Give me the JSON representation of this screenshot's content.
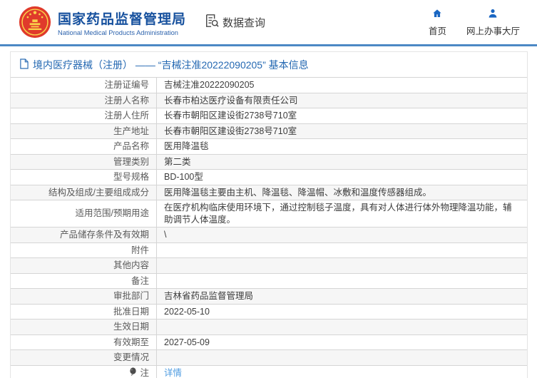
{
  "header": {
    "emblem_icon": "china-national-emblem",
    "title_cn": "国家药品监督管理局",
    "title_en": "National Medical Products Administration",
    "data_query": {
      "label": "数据查询",
      "icon": "document-search-icon"
    },
    "nav": [
      {
        "label": "首页",
        "icon": "home-icon"
      },
      {
        "label": "网上办事大厅",
        "icon": "person-icon"
      }
    ]
  },
  "breadcrumb": {
    "icon": "document-icon",
    "text": "境内医疗器械（注册） —— “吉械注准20222090205” 基本信息"
  },
  "table": {
    "rows": [
      {
        "label": "注册证编号",
        "value": "吉械注准20222090205"
      },
      {
        "label": "注册人名称",
        "value": "长春市柏达医疗设备有限责任公司"
      },
      {
        "label": "注册人住所",
        "value": "长春市朝阳区建设街2738号710室"
      },
      {
        "label": "生产地址",
        "value": "长春市朝阳区建设街2738号710室"
      },
      {
        "label": "产品名称",
        "value": "医用降温毯"
      },
      {
        "label": "管理类别",
        "value": "第二类"
      },
      {
        "label": "型号规格",
        "value": "BD-100型"
      },
      {
        "label": "结构及组成/主要组成成分",
        "value": "医用降温毯主要由主机、降温毯、降温帽、冰敷和温度传感器组成。"
      },
      {
        "label": "适用范围/预期用途",
        "value": "在医疗机构临床使用环境下，通过控制毯子温度，具有对人体进行体外物理降温功能，辅助调节人体温度。"
      },
      {
        "label": "产品储存条件及有效期",
        "value": "\\"
      },
      {
        "label": "附件",
        "value": ""
      },
      {
        "label": "其他内容",
        "value": ""
      },
      {
        "label": "备注",
        "value": ""
      },
      {
        "label": "审批部门",
        "value": "吉林省药品监督管理局"
      },
      {
        "label": "批准日期",
        "value": "2022-05-10"
      },
      {
        "label": "生效日期",
        "value": ""
      },
      {
        "label": "有效期至",
        "value": "2027-05-09"
      },
      {
        "label": "变更情况",
        "value": ""
      },
      {
        "label": "注",
        "label_icon": "balloon-icon",
        "value": "详情",
        "link": true
      }
    ]
  },
  "colors": {
    "brand_blue": "#17519e",
    "accent_blue": "#2468b2",
    "divider_blue": "#4c88c5",
    "link_blue": "#4d9be0",
    "emblem_red": "#e03a2b",
    "emblem_gold": "#f9d24a",
    "alt_row_bg": "#f6f6f6",
    "table_border": "#d5d5d5"
  }
}
